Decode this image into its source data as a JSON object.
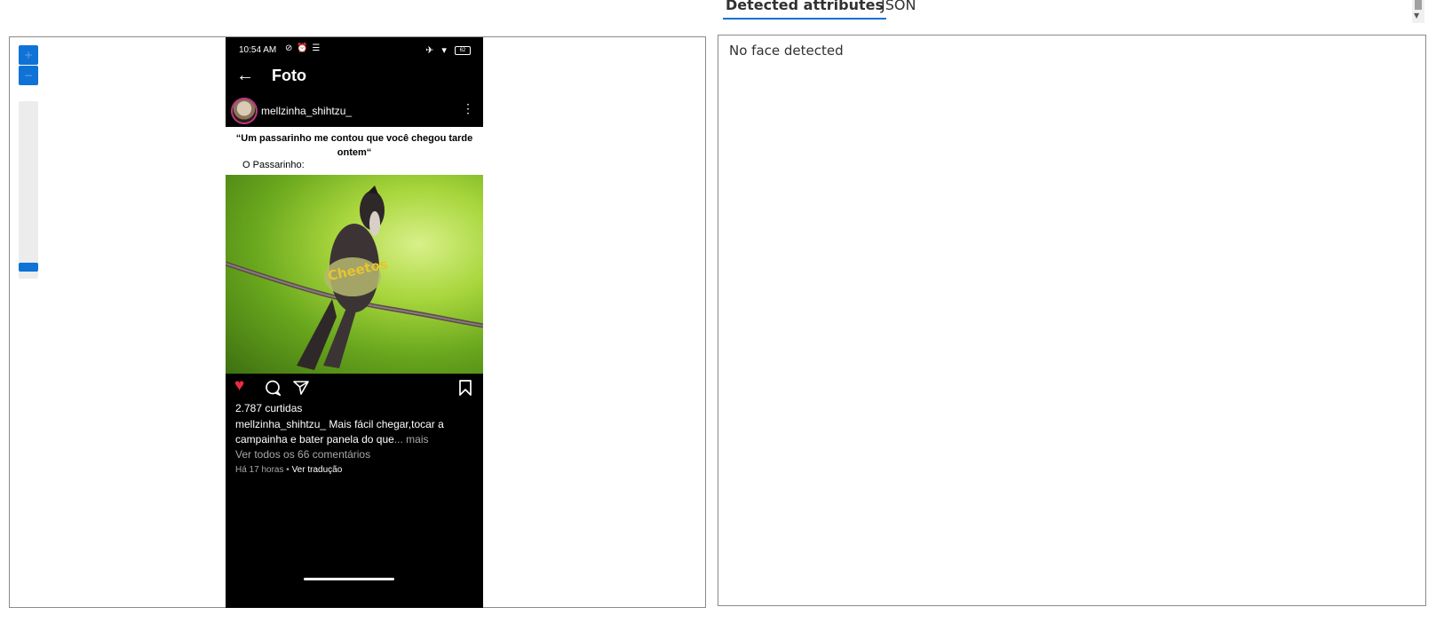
{
  "viewer": {
    "zoom_in_label": "+",
    "zoom_out_label": "−",
    "zoom_level": 0.05
  },
  "phone": {
    "status": {
      "time": "10:54 AM",
      "left_icons": "⊘ ⏰ ☰",
      "right_icons": "✈ ▾",
      "battery": "62"
    },
    "title": "Foto",
    "post": {
      "username": "mellzinha_shihtzu_",
      "meme_quote": "“Um passarinho me contou que você chegou tarde ontem“",
      "meme_caption": "O Passarinho:",
      "photo_text": "Cheetos",
      "likes": "2.787 curtidas",
      "caption_user": "mellzinha_shihtzu_",
      "caption_text": " Mais fácil chegar,tocar a campainha e bater panela do que",
      "caption_more": "... mais",
      "view_comments": "Ver todos os 66 comentários",
      "time_ago": "Há 17 horas",
      "separator": "•",
      "translate": "Ver tradução"
    }
  },
  "tabs": [
    {
      "label": "Detected attributes"
    },
    {
      "label": "JSON"
    }
  ],
  "result": {
    "message": "No face detected"
  },
  "colors": {
    "accent": "#0f72d6",
    "like": "#ed2b3c"
  }
}
